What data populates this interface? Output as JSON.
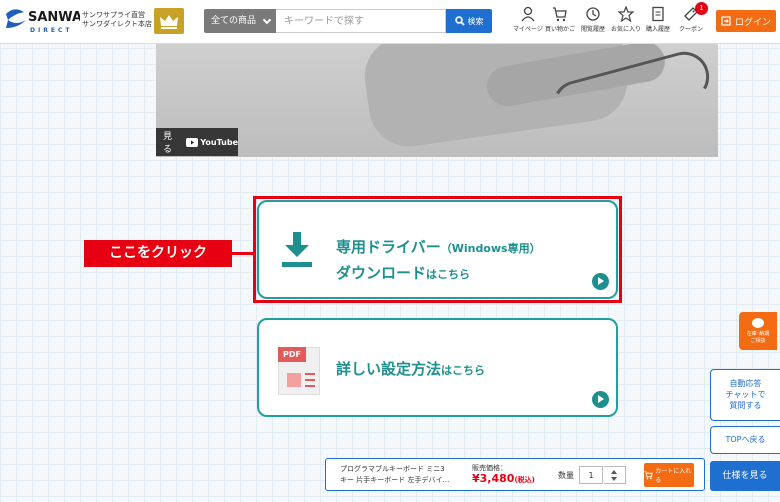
{
  "header": {
    "logo_text": "SANWA",
    "logo_sub": "DIRECT",
    "subtitle_line1": "サンワサプライ直営",
    "subtitle_line2": "サンワダイレクト本店",
    "category_label": "全ての商品",
    "search_placeholder": "キーワードで探す",
    "search_button": "検索",
    "nav": [
      {
        "label": "マイページ",
        "icon": "person-icon"
      },
      {
        "label": "買い物かご",
        "icon": "cart-icon"
      },
      {
        "label": "閲覧履歴",
        "icon": "history-icon"
      },
      {
        "label": "お気に入り",
        "icon": "star-icon"
      },
      {
        "label": "購入履歴",
        "icon": "receipt-icon"
      },
      {
        "label": "クーポン",
        "icon": "coupon-icon"
      }
    ],
    "coupon_badge": "1",
    "login_label": "ログイン"
  },
  "video": {
    "watch_label": "見る",
    "youtube_label": "YouTube"
  },
  "callout": "ここをクリック",
  "driver_card": {
    "line1_main": "専用ドライバー",
    "line1_small": "（Windows専用）",
    "line2_main": "ダウンロード",
    "line2_small": "はこちら"
  },
  "pdf_card": {
    "pdf_label": "PDF",
    "title_main": "詳しい設定方法",
    "title_small": "はこちら"
  },
  "side": {
    "stock_label_line1": "在庫･納期",
    "stock_label_line2": "ご相談",
    "chat_line1": "自動応答",
    "chat_line2": "チャットで",
    "chat_line3": "質問する",
    "top_label": "TOPへ戻る"
  },
  "cart_bar": {
    "product_line1": "プログラマブルキーボード ミニ3",
    "product_line2": "キー 片手キーボード 左手デバイ…",
    "price_label": "販売価格：",
    "price": "¥3,480",
    "tax": "(税込)",
    "qty_label": "数量",
    "qty_value": "1",
    "add_to_cart": "カートに入れる",
    "more_label": "仕様を見る"
  },
  "colors": {
    "accent": "#1f6fd1",
    "teal": "#1e8f8f",
    "orange": "#f36b13",
    "red": "#e60012"
  }
}
